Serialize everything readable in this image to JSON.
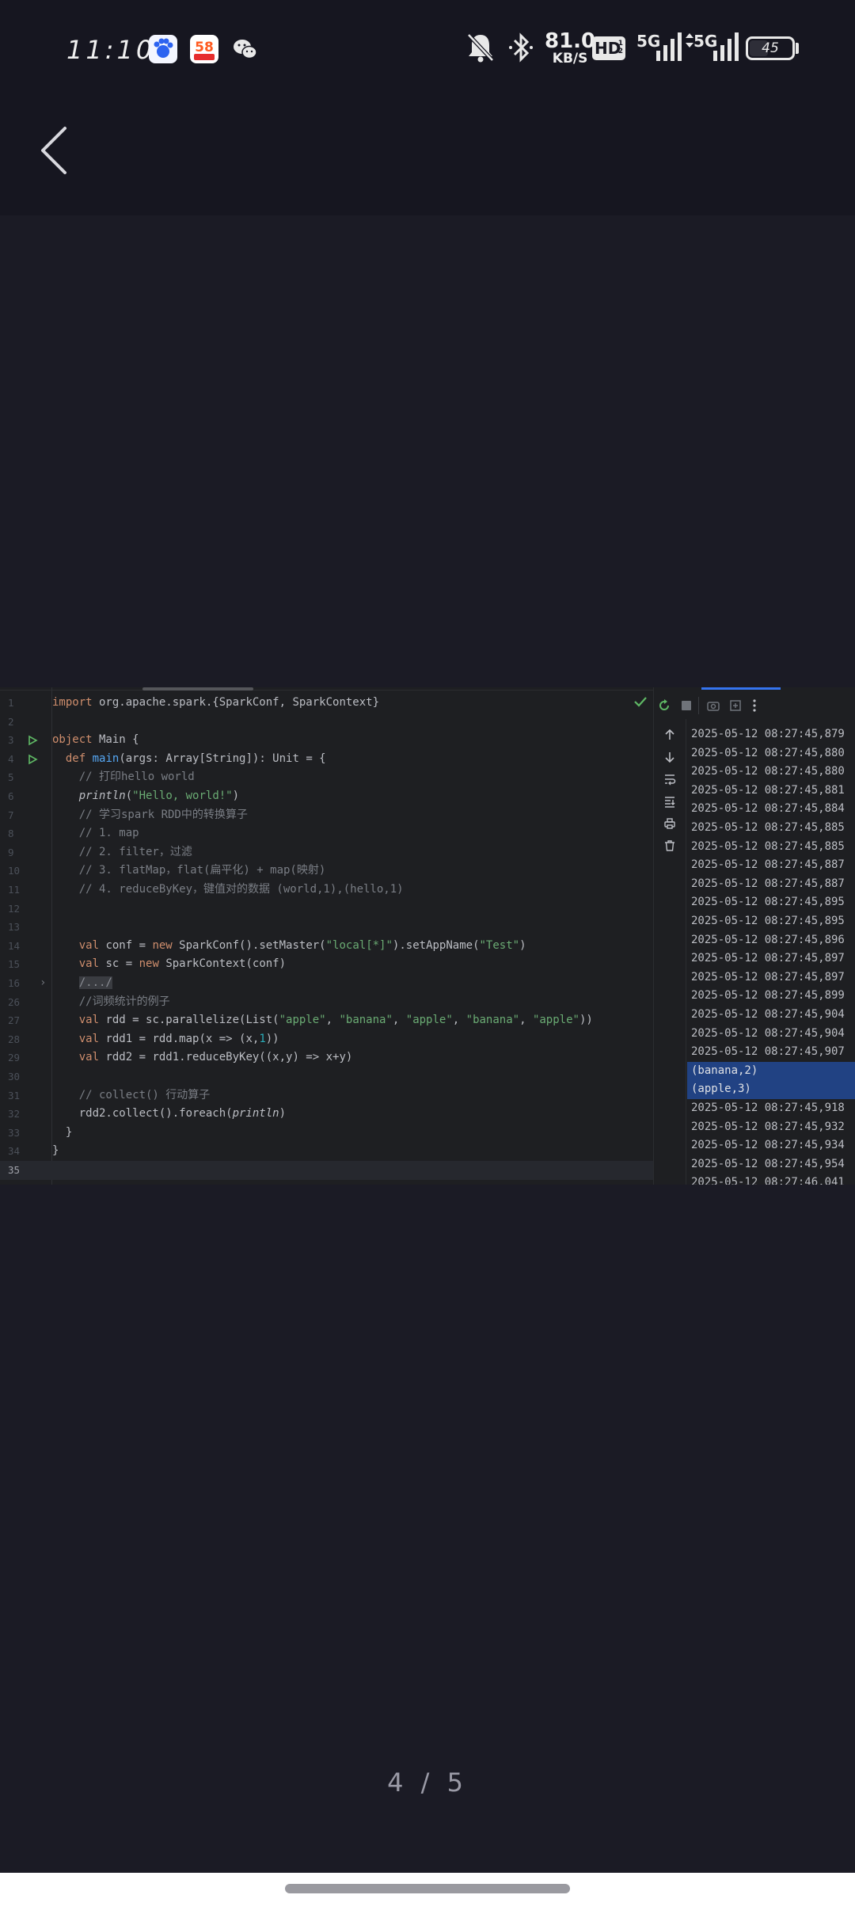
{
  "status_bar": {
    "time": "11:10",
    "apps": [
      "baidu-icon",
      "58-icon",
      "wechat-icon"
    ],
    "network_speed_value": "81.0",
    "network_speed_unit": "KB/S",
    "hd_label": "HD",
    "signal_1_label": "5G",
    "signal_2_label": "5G",
    "battery_percent": "45",
    "battery_level": 0.45
  },
  "nav": {
    "back_icon": "chevron-left-icon"
  },
  "editor": {
    "lines": [
      {
        "n": "1",
        "html": "<span class=\"kw\">import</span> org.apache.spark.{SparkConf, SparkContext}"
      },
      {
        "n": "2",
        "html": ""
      },
      {
        "n": "3",
        "html": "<span class=\"kw\">object</span> Main {",
        "run": true
      },
      {
        "n": "4",
        "html": "  <span class=\"kw\">def</span> <span class=\"fn\">main</span>(args: Array[String]): Unit = {",
        "run": true
      },
      {
        "n": "5",
        "html": "    <span class=\"cm\">// 打印hello world</span>"
      },
      {
        "n": "6",
        "html": "    <span class=\"it\">println</span>(<span class=\"str\">\"Hello, world!\"</span>)"
      },
      {
        "n": "7",
        "html": "    <span class=\"cm\">// 学习spark RDD中的转换算子</span>"
      },
      {
        "n": "8",
        "html": "    <span class=\"cm\">// 1. map</span>"
      },
      {
        "n": "9",
        "html": "    <span class=\"cm\">// 2. filter，过滤</span>"
      },
      {
        "n": "10",
        "html": "    <span class=\"cm\">// 3. flatMap，flat(扁平化) + map(映射)</span>"
      },
      {
        "n": "11",
        "html": "    <span class=\"cm\">// 4. reduceByKey，键值对的数据 (world,1),(hello,1)</span>"
      },
      {
        "n": "12",
        "html": ""
      },
      {
        "n": "13",
        "html": ""
      },
      {
        "n": "14",
        "html": "    <span class=\"kw\">val</span> conf = <span class=\"kw\">new</span> SparkConf().setMaster(<span class=\"str\">\"local[*]\"</span>).setAppName(<span class=\"str\">\"Test\"</span>)"
      },
      {
        "n": "15",
        "html": "    <span class=\"kw\">val</span> sc = <span class=\"kw\">new</span> SparkContext(conf)"
      },
      {
        "n": "16",
        "html": "    <span class=\"fold\">/.../</span>",
        "fold": true
      },
      {
        "n": "26",
        "html": "    <span class=\"cm\">//词频统计的例子</span>"
      },
      {
        "n": "27",
        "html": "    <span class=\"kw\">val</span> rdd = sc.parallelize(List(<span class=\"str\">\"apple\"</span>, <span class=\"str\">\"banana\"</span>, <span class=\"str\">\"apple\"</span>, <span class=\"str\">\"banana\"</span>, <span class=\"str\">\"apple\"</span>))"
      },
      {
        "n": "28",
        "html": "    <span class=\"kw\">val</span> rdd1 = rdd.map(x => (x,<span class=\"num\">1</span>))"
      },
      {
        "n": "29",
        "html": "    <span class=\"kw\">val</span> rdd2 = rdd1.reduceByKey((x,y) => x+y)"
      },
      {
        "n": "30",
        "html": ""
      },
      {
        "n": "31",
        "html": "    <span class=\"cm\">// collect() 行动算子</span>"
      },
      {
        "n": "32",
        "html": "    rdd2.collect().foreach(<span class=\"it\">println</span>)"
      },
      {
        "n": "33",
        "html": "  }"
      },
      {
        "n": "34",
        "html": "}"
      },
      {
        "n": "35",
        "html": "",
        "current": true
      }
    ]
  },
  "console": {
    "lines": [
      {
        "t": "2025-05-12 08:27:45,879"
      },
      {
        "t": "2025-05-12 08:27:45,880"
      },
      {
        "t": "2025-05-12 08:27:45,880"
      },
      {
        "t": "2025-05-12 08:27:45,881"
      },
      {
        "t": "2025-05-12 08:27:45,884"
      },
      {
        "t": "2025-05-12 08:27:45,885"
      },
      {
        "t": "2025-05-12 08:27:45,885"
      },
      {
        "t": "2025-05-12 08:27:45,887"
      },
      {
        "t": "2025-05-12 08:27:45,887"
      },
      {
        "t": "2025-05-12 08:27:45,895"
      },
      {
        "t": "2025-05-12 08:27:45,895"
      },
      {
        "t": "2025-05-12 08:27:45,896"
      },
      {
        "t": "2025-05-12 08:27:45,897"
      },
      {
        "t": "2025-05-12 08:27:45,897"
      },
      {
        "t": "2025-05-12 08:27:45,899"
      },
      {
        "t": "2025-05-12 08:27:45,904"
      },
      {
        "t": "2025-05-12 08:27:45,904"
      },
      {
        "t": "2025-05-12 08:27:45,907"
      },
      {
        "t": "(banana,2)",
        "sel": true
      },
      {
        "t": "(apple,3)",
        "sel": true
      },
      {
        "t": "2025-05-12 08:27:45,918"
      },
      {
        "t": "2025-05-12 08:27:45,932"
      },
      {
        "t": "2025-05-12 08:27:45,934"
      },
      {
        "t": "2025-05-12 08:27:45,954"
      },
      {
        "t": "2025-05-12 08:27:46,041"
      }
    ]
  },
  "pager": {
    "text": "4 / 5"
  }
}
